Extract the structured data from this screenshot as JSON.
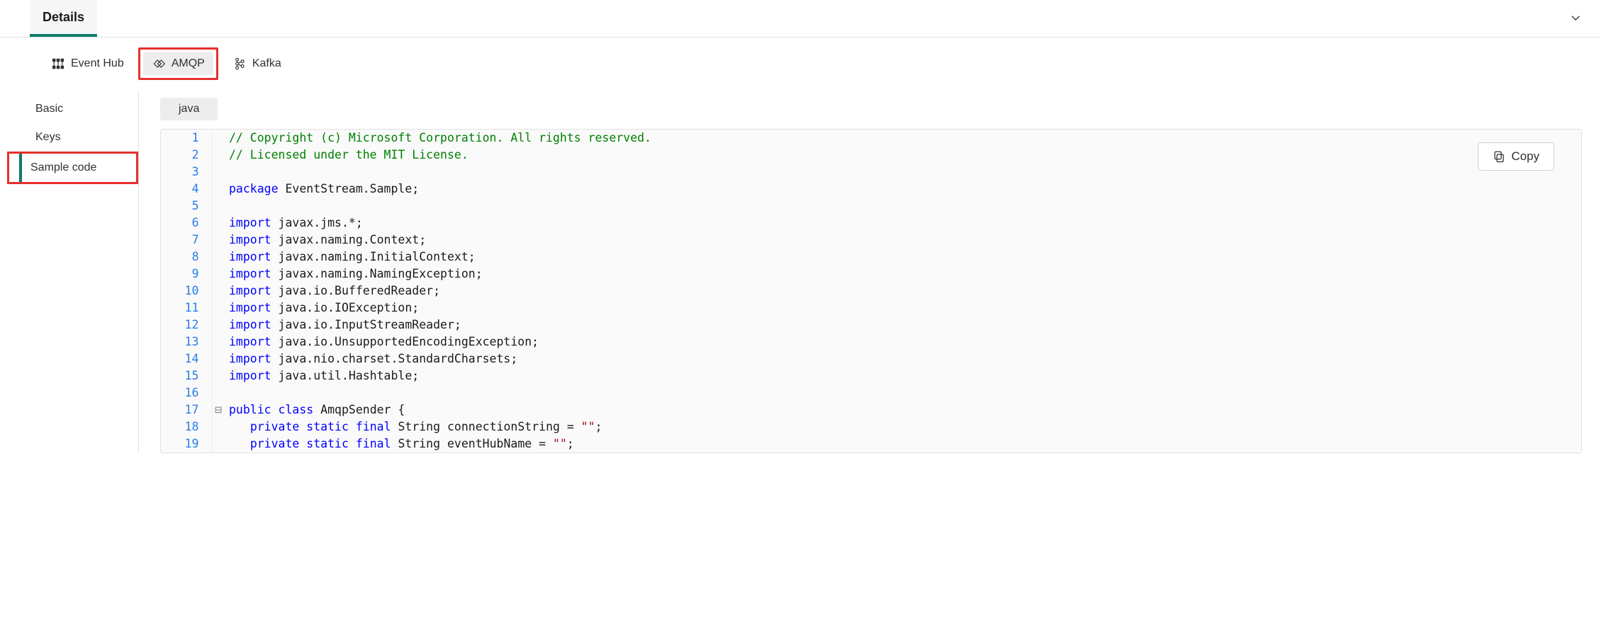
{
  "header": {
    "details_label": "Details"
  },
  "subtabs": {
    "event_hub": "Event Hub",
    "amqp": "AMQP",
    "kafka": "Kafka"
  },
  "sidebar": {
    "basic": "Basic",
    "keys": "Keys",
    "sample_code": "Sample code"
  },
  "language_pill": "java",
  "copy_label": "Copy",
  "code_lines": {
    "l1": {
      "n": "1"
    },
    "l2": {
      "n": "2"
    },
    "l3": {
      "n": "3"
    },
    "l4": {
      "n": "4"
    },
    "l5": {
      "n": "5"
    },
    "l6": {
      "n": "6"
    },
    "l7": {
      "n": "7"
    },
    "l8": {
      "n": "8"
    },
    "l9": {
      "n": "9"
    },
    "l10": {
      "n": "10"
    },
    "l11": {
      "n": "11"
    },
    "l12": {
      "n": "12"
    },
    "l13": {
      "n": "13"
    },
    "l14": {
      "n": "14"
    },
    "l15": {
      "n": "15"
    },
    "l16": {
      "n": "16"
    },
    "l17": {
      "n": "17"
    },
    "l18": {
      "n": "18"
    },
    "l19": {
      "n": "19"
    }
  },
  "code": {
    "c1": "// Copyright (c) Microsoft Corporation. All rights reserved.",
    "c2": "// Licensed under the MIT License.",
    "kw_package": "package",
    "pkg_name": " EventStream.Sample;",
    "kw_import": "import",
    "imp6": " javax.jms.*;",
    "imp7": " javax.naming.Context;",
    "imp8": " javax.naming.InitialContext;",
    "imp9": " javax.naming.NamingException;",
    "imp10": " java.io.BufferedReader;",
    "imp11": " java.io.IOException;",
    "imp12": " java.io.InputStreamReader;",
    "imp13": " java.io.UnsupportedEncodingException;",
    "imp14": " java.nio.charset.StandardCharsets;",
    "imp15": " java.util.Hashtable;",
    "kw_public": "public",
    "kw_class": "class",
    "class_name": " AmqpSender {",
    "kw_private": "private",
    "kw_static": "static",
    "kw_final": "final",
    "type_string": " String ",
    "field_conn": "connectionString = ",
    "field_hub": "eventHubName = ",
    "empty_str": "\"\"",
    "semicolon": ";"
  }
}
